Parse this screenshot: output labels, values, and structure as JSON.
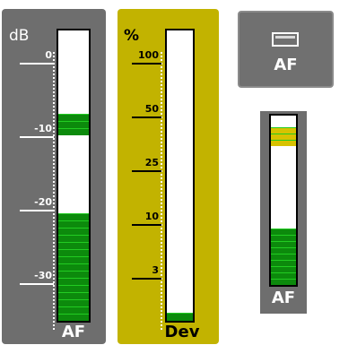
{
  "colors": {
    "panel": "#6e6e6e",
    "dev_panel": "#c2b300",
    "green": "#0c8a0c",
    "green_light": "#22cc22",
    "yellow": "#d8c200"
  },
  "af_meter": {
    "unit": "dB",
    "ticks": [
      "0",
      "-10",
      "-20",
      "-30"
    ],
    "label": "AF",
    "level_fraction": 0.39,
    "peak_fraction": 0.64
  },
  "dev_meter": {
    "unit": "%",
    "ticks": [
      "100",
      "50",
      "25",
      "10",
      "3"
    ],
    "label": "Dev",
    "level_fraction": 0.04
  },
  "af_button": {
    "label": "AF",
    "icon": "window-icon"
  },
  "small_meter": {
    "label": "AF",
    "level_fraction": 0.34,
    "peak_fraction": 0.82
  }
}
